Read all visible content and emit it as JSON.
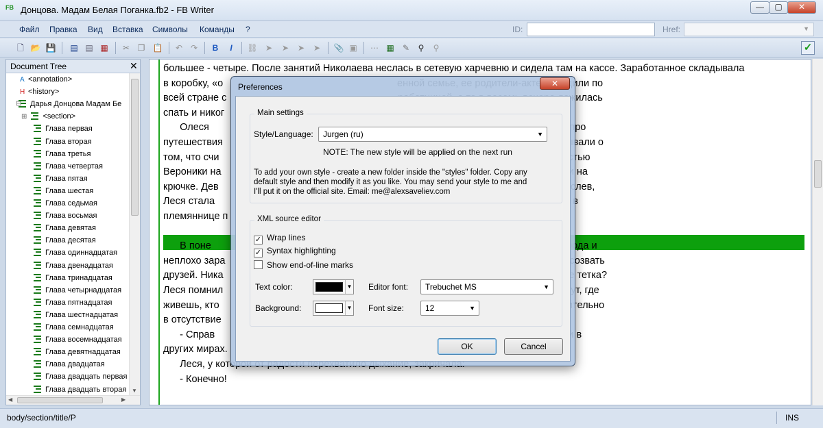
{
  "window": {
    "title": "Донцова. Мадам Белая Поганка.fb2 - FB Writer",
    "app_icon": "FB",
    "min": "—",
    "max": "▢",
    "close": "✕"
  },
  "menu": [
    "Файл",
    "Правка",
    "Вид",
    "Вставка",
    "Символы",
    "Команды",
    "?"
  ],
  "id_label": "ID:",
  "href_label": "Href:",
  "toolbar_icons": [
    "new-icon",
    "open-icon",
    "save-icon",
    "view-tree-icon",
    "view-desc-icon",
    "view-source-icon",
    "cut-icon",
    "copy-icon",
    "paste-icon",
    "undo-icon",
    "redo-icon",
    "bold-icon",
    "italic-icon",
    "link-icon",
    "tag-icon",
    "tag2-icon",
    "tag3-icon",
    "tag4-icon",
    "attach-icon",
    "image-icon",
    "nbsp-icon",
    "table-icon",
    "spell-icon",
    "find-icon",
    "replace-icon",
    "validate-icon"
  ],
  "tree": {
    "title": "Document Tree",
    "items": [
      {
        "type": "A",
        "label": "<annotation>"
      },
      {
        "type": "H",
        "label": "<history>"
      },
      {
        "type": "book",
        "label": "Дарья Донцова Мадам Бе"
      },
      {
        "type": "sec",
        "label": "<section>"
      },
      {
        "type": "sec",
        "label": "Глава первая"
      },
      {
        "type": "sec",
        "label": "Глава вторая"
      },
      {
        "type": "sec",
        "label": "Глава третья"
      },
      {
        "type": "sec",
        "label": "Глава четвертая"
      },
      {
        "type": "sec",
        "label": "Глава пятая"
      },
      {
        "type": "sec",
        "label": "Глава шестая"
      },
      {
        "type": "sec",
        "label": "Глава седьмая"
      },
      {
        "type": "sec",
        "label": "Глава восьмая"
      },
      {
        "type": "sec",
        "label": "Глава девятая"
      },
      {
        "type": "sec",
        "label": "Глава десятая"
      },
      {
        "type": "sec",
        "label": "Глава одиннадцатая"
      },
      {
        "type": "sec",
        "label": "Глава двенадцатая"
      },
      {
        "type": "sec",
        "label": "Глава тринадцатая"
      },
      {
        "type": "sec",
        "label": "Глава четырнадцатая"
      },
      {
        "type": "sec",
        "label": "Глава пятнадцатая"
      },
      {
        "type": "sec",
        "label": "Глава шестнадцатая"
      },
      {
        "type": "sec",
        "label": "Глава семнадцатая"
      },
      {
        "type": "sec",
        "label": "Глава восемнадцатая"
      },
      {
        "type": "sec",
        "label": "Глава девятнадцатая"
      },
      {
        "type": "sec",
        "label": "Глава двадцатая"
      },
      {
        "type": "sec",
        "label": "Глава двадцать первая"
      },
      {
        "type": "sec",
        "label": "Глава двадцать вторая"
      }
    ]
  },
  "editor": {
    "lines": [
      "большее - четыре. После занятий Николаева неслась в сетевую харчевню и сидела там на кассе. Заработанное складывала",
      "в коробку, «о                                                               енной семье, ее родители-актеры ездили по",
      "всей стране с                                                              работницей, а та в восемь вечера ложилась",
      "спать и никог",
      "      Олеся                                                                рка, волшебница Хиония, которая врет про",
      "путешествия                                                                тавшись вдвоем, никому не рассказывали о",
      "том, что счи                                                               Олеся, и Галя восхищались способностью",
      "Вероники на                                                                клиентов, которые сидели у Вероники на",
      "крючке. Дев                                                                 то вела их пообедать в кафе. Повзрослев,",
      "Леся стала                                                                  Фомина ее любит, просто боится, что в",
      "племяннице п",
      "",
      "      В поне                                                                правлялась читать лекции в разные города и",
      "неплохо зара                                                               овсем приуныла, ей давно хотелось созвать",
      "друзей. Ника                                                               жно веселиться от души, когда в доме тетка?",
      "Леся помнил                                                                сем подросткам допрос: как тебя зовут, где",
      "живешь, кто                                                                перь она собирала компании исключительно",
      "в отсутствие",
      "      - Справ                                                               ь перед людьми, рассказать им о жизни в",
      "других мирах.",
      "      Леся, у которой от радости перехватило дыхание, закричала:",
      "      - Конечно!"
    ]
  },
  "status": {
    "path": "body/section/title/P",
    "mode": "INS"
  },
  "dialog": {
    "title": "Preferences",
    "close": "✕",
    "main_settings_title": "Main settings",
    "style_label": "Style/Language:",
    "style_value": "Jurgen (ru)",
    "note": "NOTE: The new style will be applied on the next run",
    "help1": "To add your own style - create a new folder inside the \"styles\" folder. Copy any",
    "help2": "default style and then modify it as you like. You may send your style to me and",
    "help3": "I'll put it on the official site. Email: me@alexsaveliev.com",
    "xml_title": "XML source editor",
    "wrap_label": "Wrap lines",
    "wrap_checked": true,
    "syntax_label": "Syntax highlighting",
    "syntax_checked": true,
    "eol_label": "Show end-of-line marks",
    "eol_checked": false,
    "text_color_label": "Text color:",
    "text_color": "#000000",
    "background_label": "Background:",
    "background_color": "#ffffff",
    "editor_font_label": "Editor font:",
    "editor_font_value": "Trebuchet MS",
    "font_size_label": "Font size:",
    "font_size_value": "12",
    "ok": "OK",
    "cancel": "Cancel",
    "check": "✓"
  },
  "colors": {
    "accent_green": "#0da00d",
    "margin_green": "#1da51d"
  }
}
